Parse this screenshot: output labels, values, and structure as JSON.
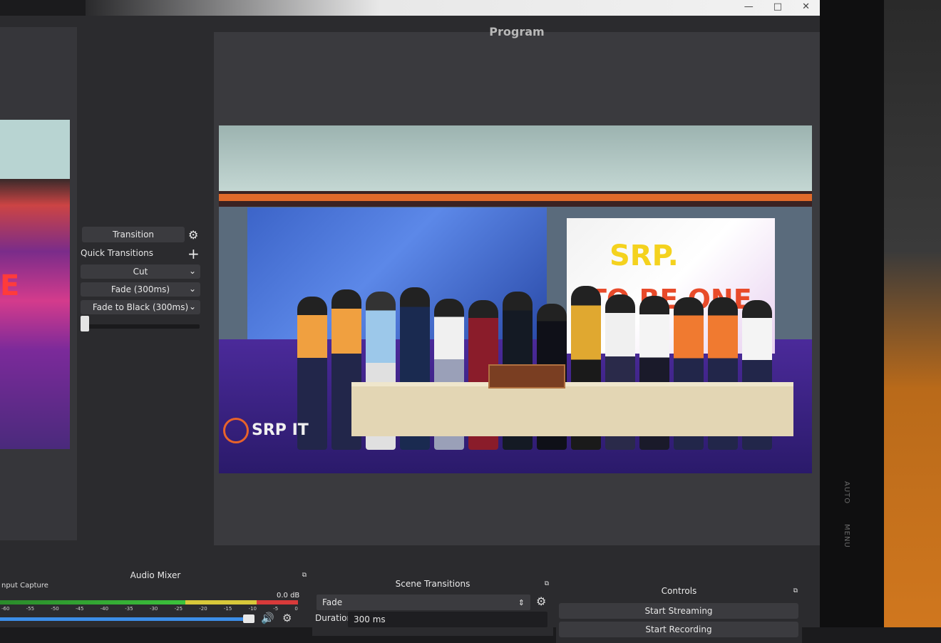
{
  "window": {
    "minimize": "—",
    "maximize": "□",
    "close": "✕"
  },
  "program": {
    "title": "Program"
  },
  "transition": {
    "button_label": "Transition",
    "quick_transitions_label": "Quick Transitions",
    "items": [
      "Cut",
      "Fade (300ms)",
      "Fade to Black (300ms)"
    ]
  },
  "scene_image": {
    "backdrop_title": "SRP.",
    "backdrop_subtitle": "TO BE ONE",
    "watermark": "SRP IT"
  },
  "audio_mixer": {
    "title": "Audio Mixer",
    "source_label": "nput Capture",
    "level": "0.0 dB",
    "scale": [
      "-60",
      "-55",
      "-50",
      "-45",
      "-40",
      "-35",
      "-30",
      "-25",
      "-20",
      "-15",
      "-10",
      "-5",
      "0"
    ]
  },
  "scene_transitions": {
    "title": "Scene Transitions",
    "selected": "Fade",
    "duration_label": "Duration",
    "duration_value": "300 ms"
  },
  "controls": {
    "title": "Controls",
    "start_streaming": "Start Streaming",
    "start_recording": "Start Recording"
  },
  "bezel": {
    "auto": "AUTO",
    "menu": "MENU"
  },
  "colors": {
    "accent_orange": "#e8632a",
    "meter_green": "#3cc23c",
    "meter_blue": "#3c8ee8"
  }
}
